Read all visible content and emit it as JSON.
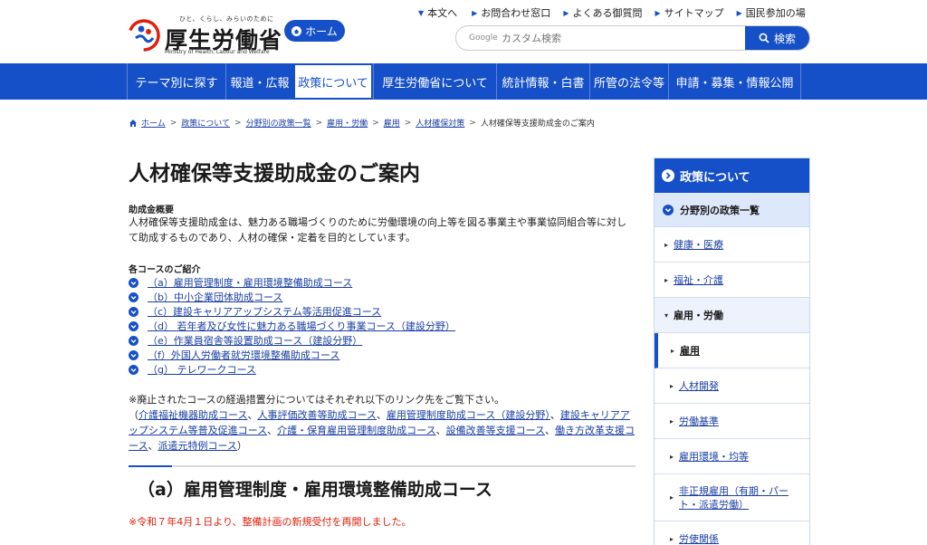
{
  "header": {
    "logo_tagline": "ひと、くらし、みらいのために",
    "logo_name": "厚生労働省",
    "logo_en": "Ministry of Health, Labour and Welfare",
    "home_label": "ホーム",
    "util_links": [
      "本文へ",
      "お問合わせ窓口",
      "よくある御質問",
      "サイトマップ",
      "国民参加の場"
    ],
    "search_brand": "Google",
    "search_placeholder": "カスタム検索",
    "search_button": "検索"
  },
  "nav": {
    "items": [
      "テーマ別に探す",
      "報道・広報",
      "政策について",
      "厚生労働省について",
      "統計情報・白書",
      "所管の法令等",
      "申請・募集・情報公開"
    ],
    "active_index": 2
  },
  "breadcrumb": {
    "links": [
      "ホーム",
      "政策について",
      "分野別の政策一覧",
      "雇用・労働",
      "雇用",
      "人材確保対策"
    ],
    "current": "人材確保等支援助成金のご案内"
  },
  "main": {
    "title": "人材確保等支援助成金のご案内",
    "overview_label": "助成金概要",
    "overview_text": "人材確保等支援助成金は、魅力ある職場づくりのために労働環境の向上等を図る事業主や事業協同組合等に対して助成するものであり、人材の確保・定着を目的としています。",
    "courses_label": "各コースのご紹介",
    "courses": [
      "（a）雇用管理制度・雇用環境整備助成コース",
      "（b）中小企業団体助成コース",
      "（c）建設キャリアアップシステム等活用促進コース",
      "（d） 若年者及び女性に魅力ある職場づくり事業コース（建設分野）",
      "（e）作業員宿舎等設置助成コース（建設分野）",
      "（f）外国人労働者就労環境整備助成コース",
      "（g） テレワークコース"
    ],
    "note_intro": "※廃止されたコースの経過措置分についてはそれぞれ以下のリンク先をご覧下さい。",
    "note_open": "（",
    "note_links": [
      "介護福祉機器助成コース",
      "人事評価改善等助成コース",
      "雇用管理制度助成コース（建設分野）",
      "建設キャリアアップシステム等普及促進コース",
      "介護・保育雇用管理制度助成コース",
      "設備改善等支援コース",
      "働き方改革支援コース",
      "派遣元特例コース"
    ],
    "note_sep": "、",
    "note_close": "）",
    "section_heading": "（a）雇用管理制度・雇用環境整備助成コース",
    "notice": "※令和７年4月１日より、整備計画の新規受付を再開しました。"
  },
  "sidebar": {
    "title": "政策について",
    "sub": "分野別の政策一覧",
    "items": [
      "健康・医療",
      "福祉・介護"
    ],
    "group": "雇用・労働",
    "current": "雇用",
    "children": [
      "人材開発",
      "労働基準",
      "雇用環境・均等",
      "非正規雇用（有期・パート・派遣労働）",
      "労使関係"
    ]
  },
  "colors": {
    "brand_blue": "#1650c8",
    "link": "#1a3fa3",
    "notice_red": "#e0200c"
  }
}
